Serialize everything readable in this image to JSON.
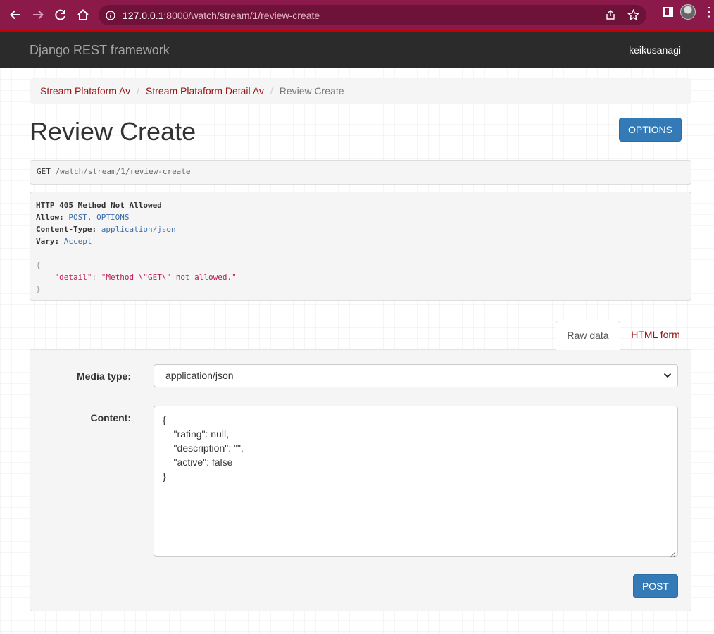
{
  "browser": {
    "url_host": "127.0.0.1",
    "url_path": ":8000/watch/stream/1/review-create"
  },
  "navbar": {
    "brand": "Django REST framework",
    "user": "keikusanagi"
  },
  "breadcrumb": {
    "items": [
      "Stream Plataform Av",
      "Stream Plataform Detail Av"
    ],
    "active": "Review Create"
  },
  "page": {
    "title": "Review Create",
    "options_label": "OPTIONS"
  },
  "request": {
    "method": "GET",
    "path": "/watch/stream/1/review-create"
  },
  "response": {
    "status": "HTTP 405 Method Not Allowed",
    "headers": [
      {
        "name": "Allow:",
        "value": "POST, OPTIONS"
      },
      {
        "name": "Content-Type:",
        "value": "application/json"
      },
      {
        "name": "Vary:",
        "value": "Accept"
      }
    ],
    "body_open": "{",
    "body_key": "\"detail\"",
    "body_colon": ": ",
    "body_value": "\"Method \\\"GET\\\" not allowed.\"",
    "body_close": "}"
  },
  "tabs": {
    "raw": "Raw data",
    "html": "HTML form"
  },
  "form": {
    "media_label": "Media type:",
    "media_value": "application/json",
    "content_label": "Content:",
    "content_lines": [
      "{",
      "    \"rating\": null,",
      "    \"description\": \"\",",
      "    \"active\": false",
      "}"
    ],
    "post_label": "POST"
  },
  "colors": {
    "chrome": "#8b1a4a",
    "navbar": "#2b2b2b",
    "link": "#9b1111",
    "primary_button": "#337ab7"
  }
}
